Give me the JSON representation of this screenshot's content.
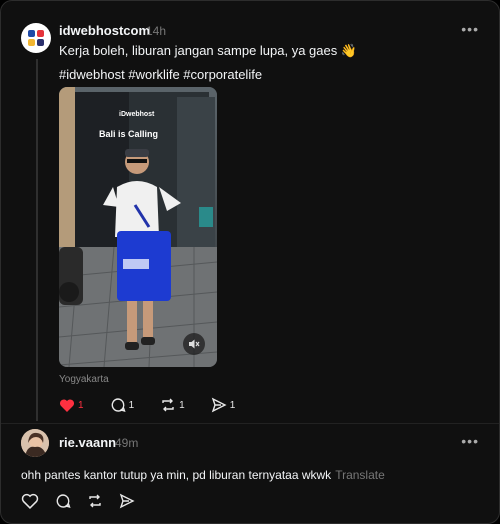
{
  "post": {
    "username": "idwebhostcom",
    "time": "14h",
    "text": "Kerja boleh, liburan jangan sampe lupa, ya gaes 👋",
    "hashtags": "#idwebhost #worklife #corporatelife",
    "video": {
      "brand": "iDwebhost",
      "caption": "Bali is Calling",
      "muted": true
    },
    "location": "Yogyakarta",
    "stats": {
      "likes": "1",
      "comments": "1",
      "reposts": "1",
      "shares": "1"
    },
    "colors": {
      "like": "#ff3040"
    }
  },
  "reply": {
    "username": "rie.vaann",
    "time": "49m",
    "text": "ohh pantes kantor tutup ya min, pd liburan ternyataa wkwk",
    "translate": "Translate"
  },
  "icons": {
    "more": "more-horizontal-icon",
    "like": "heart-icon",
    "comment": "comment-icon",
    "repost": "repost-icon",
    "share": "share-icon",
    "mute": "speaker-mute-icon"
  }
}
